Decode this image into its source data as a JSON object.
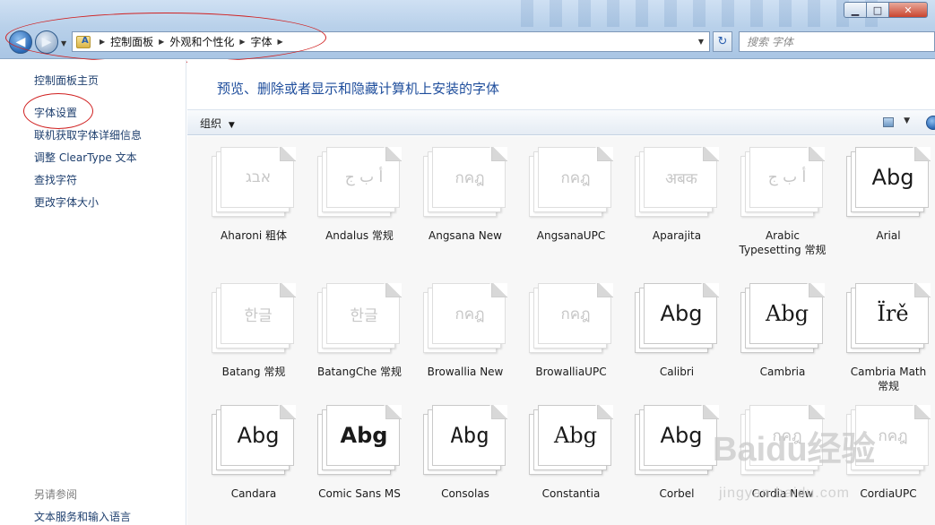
{
  "window": {
    "minimize": "▁",
    "maximize": "□",
    "close": "✕"
  },
  "address": {
    "breadcrumbs": [
      "控制面板",
      "外观和个性化",
      "字体"
    ]
  },
  "search": {
    "placeholder": "搜索 字体"
  },
  "sidebar": {
    "items": [
      {
        "label": "控制面板主页"
      },
      {
        "label": "字体设置"
      },
      {
        "label": "联机获取字体详细信息"
      },
      {
        "label": "调整 ClearType 文本"
      },
      {
        "label": "查找字符"
      },
      {
        "label": "更改字体大小"
      }
    ],
    "see_also_title": "另请参阅",
    "see_also_items": [
      {
        "label": "文本服务和输入语言"
      }
    ]
  },
  "main": {
    "title": "预览、删除或者显示和隐藏计算机上安装的字体",
    "toolbar": {
      "organize": "组织"
    }
  },
  "fonts": [
    {
      "name": "Aharoni 粗体",
      "glyph": "אבג",
      "faded": true
    },
    {
      "name": "Andalus 常规",
      "glyph": "أ ب ج",
      "faded": true
    },
    {
      "name": "Angsana New",
      "glyph": "กคฎ",
      "faded": true
    },
    {
      "name": "AngsanaUPC",
      "glyph": "กคฎ",
      "faded": true
    },
    {
      "name": "Aparajita",
      "glyph": "अबक",
      "faded": true
    },
    {
      "name": "Arabic Typesetting 常规",
      "glyph": "أ ب ج",
      "faded": true
    },
    {
      "name": "Arial",
      "glyph": "Abg",
      "faded": false
    },
    {
      "name": "Batang 常规",
      "glyph": "한글",
      "faded": true
    },
    {
      "name": "BatangChe 常规",
      "glyph": "한글",
      "faded": true
    },
    {
      "name": "Browallia New",
      "glyph": "กคฎ",
      "faded": true
    },
    {
      "name": "BrowalliaUPC",
      "glyph": "กคฎ",
      "faded": true
    },
    {
      "name": "Calibri",
      "glyph": "Abg",
      "faded": false
    },
    {
      "name": "Cambria",
      "glyph": "Abg",
      "faded": false
    },
    {
      "name": "Cambria Math 常规",
      "glyph": "Ïrě",
      "faded": false
    },
    {
      "name": "Candara",
      "glyph": "Abg",
      "faded": false
    },
    {
      "name": "Comic Sans MS",
      "glyph": "Abg",
      "faded": false
    },
    {
      "name": "Consolas",
      "glyph": "Abg",
      "faded": false
    },
    {
      "name": "Constantia",
      "glyph": "Abg",
      "faded": false
    },
    {
      "name": "Corbel",
      "glyph": "Abg",
      "faded": false
    },
    {
      "name": "Cordia New",
      "glyph": "กคฎ",
      "faded": true
    },
    {
      "name": "CordiaUPC",
      "glyph": "กคฎ",
      "faded": true
    }
  ],
  "watermark": {
    "text": "Baidu经验",
    "sub": "jingyan.baidu.com"
  }
}
